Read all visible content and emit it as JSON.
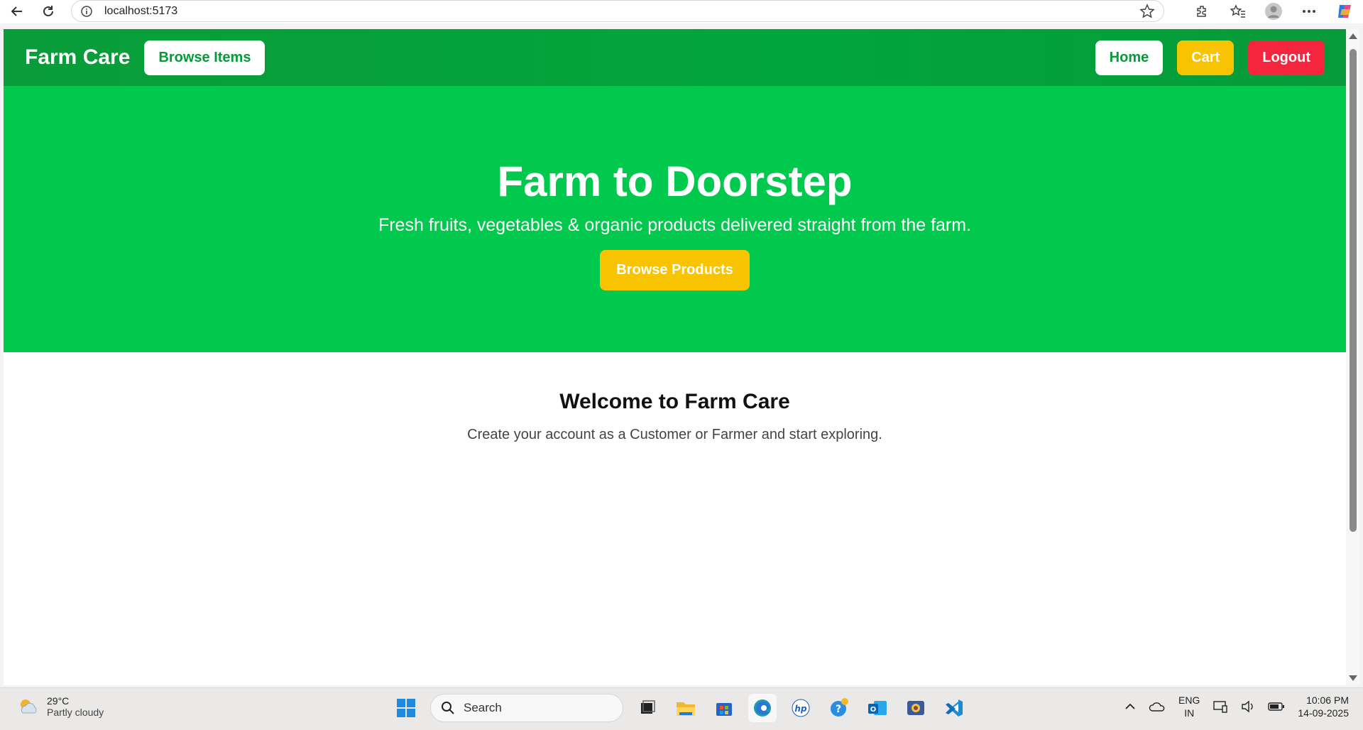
{
  "browser": {
    "url": "localhost:5173"
  },
  "site": {
    "brand": "Farm Care",
    "browse_items_label": "Browse Items",
    "nav": {
      "home_label": "Home",
      "cart_label": "Cart",
      "logout_label": "Logout"
    },
    "hero": {
      "title": "Farm to Doorstep",
      "subtitle": "Fresh fruits, vegetables & organic products delivered straight from the farm.",
      "cta_label": "Browse Products"
    },
    "welcome": {
      "title": "Welcome to Farm Care",
      "subtitle": "Create your account as a Customer or Farmer and start exploring."
    }
  },
  "taskbar": {
    "weather_temp": "29°C",
    "weather_condition": "Partly cloudy",
    "search_label": "Search",
    "lang_line1": "ENG",
    "lang_line2": "IN",
    "time": "10:06 PM",
    "date": "14-09-2025"
  },
  "colors": {
    "nav_green": "#00a63b",
    "hero_green": "#00c94d",
    "accent_yellow": "#f8c300",
    "logout_red": "#f5253f"
  }
}
